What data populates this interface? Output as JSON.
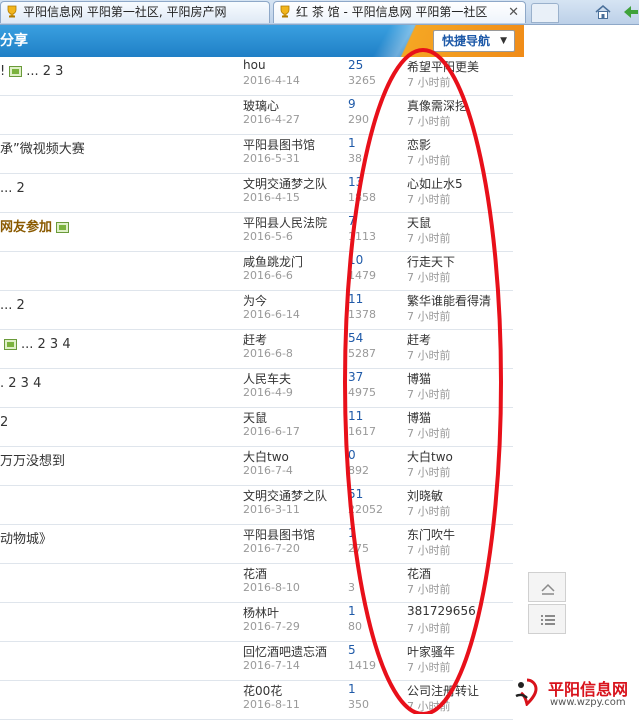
{
  "browser": {
    "tabs": [
      {
        "label": "平阳信息网 平阳第一社区, 平阳房产网"
      },
      {
        "label": "红 茶 馆 - 平阳信息网 平阳第一社区"
      }
    ]
  },
  "forum": {
    "header_title": "分享",
    "quick_nav_label": "快捷导航"
  },
  "threads": [
    {
      "title": "!",
      "has_image": true,
      "pages": "... 2 3",
      "author": "hou",
      "date": "2016-4-14",
      "replies": "25",
      "views": "3265",
      "last_poster": "希望平阳更美",
      "last_time": "7 小时前",
      "highlight": false
    },
    {
      "title": "",
      "has_image": false,
      "pages": "",
      "author": "玻璃心",
      "date": "2016-4-27",
      "replies": "9",
      "views": "290",
      "last_poster": "真像需深挖",
      "last_time": "7 小时前",
      "highlight": false
    },
    {
      "title": "承”微视频大赛",
      "has_image": false,
      "pages": "",
      "author": "平阳县图书馆",
      "date": "2016-5-31",
      "replies": "1",
      "views": "38",
      "last_poster": "恋影",
      "last_time": "7 小时前",
      "highlight": false
    },
    {
      "title": "",
      "has_image": false,
      "pages": "... 2",
      "author": "文明交通梦之队",
      "date": "2016-4-15",
      "replies": "13",
      "views": "1858",
      "last_poster": "心如止水5",
      "last_time": "7 小时前",
      "highlight": false
    },
    {
      "title": "网友参加",
      "has_image": true,
      "pages": "",
      "author": "平阳县人民法院",
      "date": "2016-5-6",
      "replies": "7",
      "views": "1113",
      "last_poster": "天鼠",
      "last_time": "7 小时前",
      "highlight": true
    },
    {
      "title": "",
      "has_image": false,
      "pages": "",
      "author": "咸鱼跳龙门",
      "date": "2016-6-6",
      "replies": "10",
      "views": "1479",
      "last_poster": "行走天下",
      "last_time": "7 小时前",
      "highlight": false
    },
    {
      "title": "",
      "has_image": false,
      "pages": "... 2",
      "author": "为今",
      "date": "2016-6-14",
      "replies": "11",
      "views": "1378",
      "last_poster": "繁华谁能看得清",
      "last_time": "7 小时前",
      "highlight": false
    },
    {
      "title": "",
      "has_image": true,
      "pages": "... 2 3 4",
      "author": "赶考",
      "date": "2016-6-8",
      "replies": "54",
      "views": "5287",
      "last_poster": "赶考",
      "last_time": "7 小时前",
      "highlight": false
    },
    {
      "title": "",
      "has_image": false,
      "pages": ". 2 3 4",
      "author": "人民车夫",
      "date": "2016-4-9",
      "replies": "37",
      "views": "4975",
      "last_poster": "博猫",
      "last_time": "7 小时前",
      "highlight": false
    },
    {
      "title": "2",
      "has_image": false,
      "pages": "",
      "author": "天鼠",
      "date": "2016-6-17",
      "replies": "11",
      "views": "1617",
      "last_poster": "博猫",
      "last_time": "7 小时前",
      "highlight": false
    },
    {
      "title": "万万没想到",
      "has_image": false,
      "pages": "",
      "author": "大白two",
      "date": "2016-7-4",
      "replies": "0",
      "views": "892",
      "last_poster": "大白two",
      "last_time": "7 小时前",
      "highlight": false
    },
    {
      "title": "",
      "has_image": false,
      "pages": "",
      "author": "文明交通梦之队",
      "date": "2016-3-11",
      "replies": "51",
      "views": "22052",
      "last_poster": "刘晓敏",
      "last_time": "7 小时前",
      "highlight": false
    },
    {
      "title": "动物城》",
      "has_image": false,
      "pages": "",
      "author": "平阳县图书馆",
      "date": "2016-7-20",
      "replies": "1",
      "views": "275",
      "last_poster": "东门吹牛",
      "last_time": "7 小时前",
      "highlight": false
    },
    {
      "title": "",
      "has_image": false,
      "pages": "",
      "author": "花酒",
      "date": "2016-8-10",
      "replies": "",
      "views": "3",
      "last_poster": "花酒",
      "last_time": "7 小时前",
      "highlight": false
    },
    {
      "title": "",
      "has_image": false,
      "pages": "",
      "author": "杨林叶",
      "date": "2016-7-29",
      "replies": "1",
      "views": "80",
      "last_poster": "381729656",
      "last_time": "7 小时前",
      "highlight": false
    },
    {
      "title": "",
      "has_image": false,
      "pages": "",
      "author": "回忆酒吧遗忘酒",
      "date": "2016-7-14",
      "replies": "5",
      "views": "1419",
      "last_poster": "叶家骚年",
      "last_time": "7 小时前",
      "highlight": false
    },
    {
      "title": "",
      "has_image": false,
      "pages": "",
      "author": "花00花",
      "date": "2016-8-11",
      "replies": "1",
      "views": "350",
      "last_poster": "公司注册转让",
      "last_time": "7 小时前",
      "highlight": false
    }
  ],
  "watermark": {
    "name": "平阳信息网",
    "url": "www.wzpy.com"
  },
  "colors": {
    "header_blue": "#1f7fc6",
    "link_blue": "#1f5aa8",
    "annotation_red": "#e8101a",
    "highlight_brown": "#8a5a00"
  },
  "icons": [
    "trophy-icon",
    "close-icon",
    "home-icon",
    "back-arrow-icon",
    "image-attachment-icon",
    "back-to-top-icon",
    "list-view-icon"
  ]
}
